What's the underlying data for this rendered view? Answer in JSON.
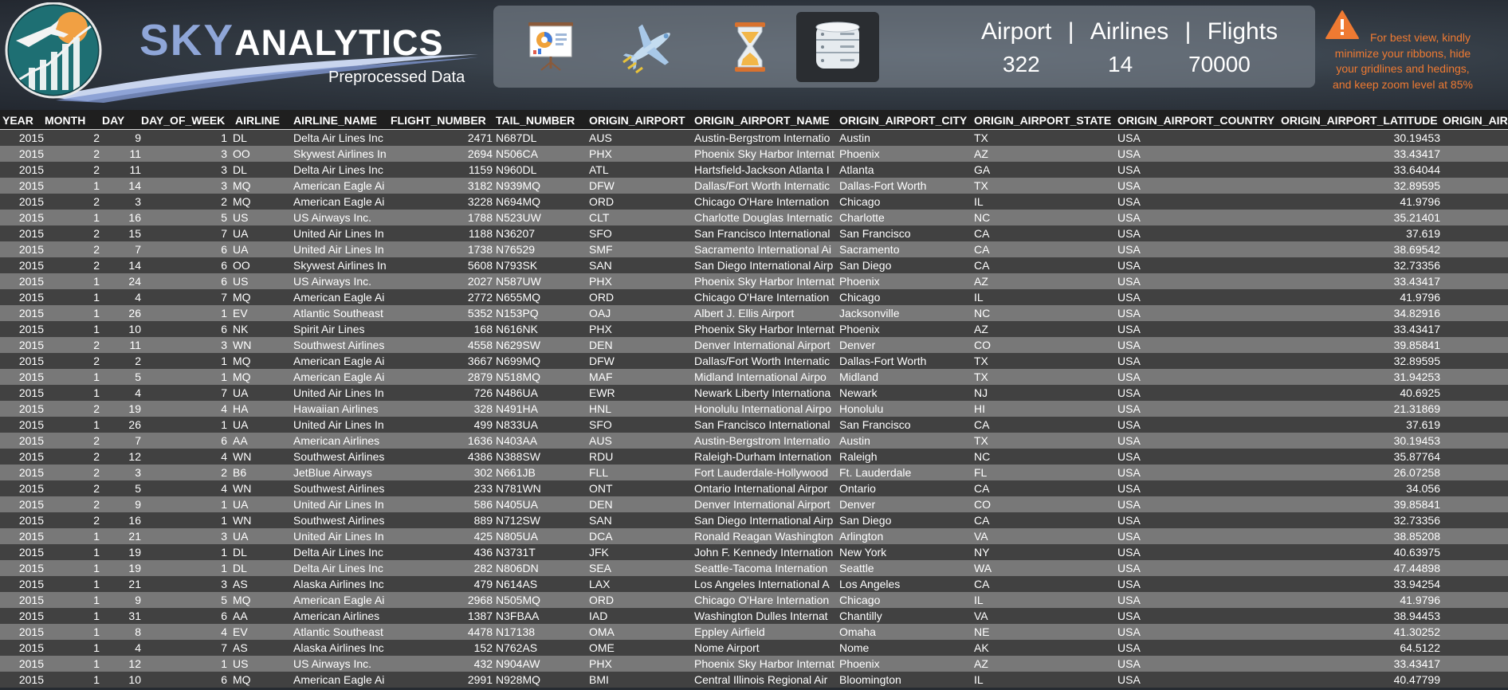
{
  "header": {
    "brand_sky": "SKY",
    "brand_analytics": "ANALYTICS",
    "subtitle": "Preprocessed Data",
    "nav": [
      {
        "name": "dashboard-presentation-icon",
        "active": false
      },
      {
        "name": "airplane-icon",
        "active": false
      },
      {
        "name": "hourglass-icon",
        "active": false
      },
      {
        "name": "database-icon",
        "active": true
      }
    ],
    "stats": {
      "labels": [
        "Airport",
        "Airlines",
        "Flights"
      ],
      "separator": "|",
      "values": [
        "322",
        "14",
        "70000"
      ]
    },
    "warning": {
      "icon": "warning-triangle-icon",
      "lines": [
        "For best view, kindly",
        "minimize your ribbons, hide",
        "your gridlines and hedings,",
        "and keep zoom level at 85%"
      ],
      "color": "#ef7a32"
    },
    "colors": {
      "brand_blue": "#8fa6d8",
      "active_tab": "#2a2d31",
      "row_dark": "#414141",
      "row_light": "#787878"
    }
  },
  "table": {
    "columns": [
      "YEAR",
      "MONTH",
      "DAY",
      "DAY_OF_WEEK",
      "AIRLINE",
      "AIRLINE_NAME",
      "FLIGHT_NUMBER",
      "TAIL_NUMBER",
      "ORIGIN_AIRPORT",
      "ORIGIN_AIRPORT_NAME",
      "ORIGIN_AIRPORT_CITY",
      "ORIGIN_AIRPORT_STATE",
      "ORIGIN_AIRPORT_COUNTRY",
      "ORIGIN_AIRPORT_LATITUDE",
      "ORIGIN_AIR"
    ],
    "rows": [
      [
        "2015",
        "2",
        "9",
        "1",
        "DL",
        "Delta Air Lines Inc",
        "2471",
        "N687DL",
        "AUS",
        "Austin-Bergstrom Internatio",
        "Austin",
        "TX",
        "USA",
        "30.19453"
      ],
      [
        "2015",
        "2",
        "11",
        "3",
        "OO",
        "Skywest Airlines In",
        "2694",
        "N506CA",
        "PHX",
        "Phoenix Sky Harbor Internat",
        "Phoenix",
        "AZ",
        "USA",
        "33.43417"
      ],
      [
        "2015",
        "2",
        "11",
        "3",
        "DL",
        "Delta Air Lines Inc",
        "1159",
        "N960DL",
        "ATL",
        "Hartsfield-Jackson Atlanta I",
        "Atlanta",
        "GA",
        "USA",
        "33.64044"
      ],
      [
        "2015",
        "1",
        "14",
        "3",
        "MQ",
        "American Eagle Ai",
        "3182",
        "N939MQ",
        "DFW",
        "Dallas/Fort Worth Internatic",
        "Dallas-Fort Worth",
        "TX",
        "USA",
        "32.89595"
      ],
      [
        "2015",
        "2",
        "3",
        "2",
        "MQ",
        "American Eagle Ai",
        "3228",
        "N694MQ",
        "ORD",
        "Chicago O'Hare Internation",
        "Chicago",
        "IL",
        "USA",
        "41.9796"
      ],
      [
        "2015",
        "1",
        "16",
        "5",
        "US",
        "US Airways Inc.",
        "1788",
        "N523UW",
        "CLT",
        "Charlotte Douglas Internatic",
        "Charlotte",
        "NC",
        "USA",
        "35.21401"
      ],
      [
        "2015",
        "2",
        "15",
        "7",
        "UA",
        "United Air Lines In",
        "1188",
        "N36207",
        "SFO",
        "San Francisco International",
        "San Francisco",
        "CA",
        "USA",
        "37.619"
      ],
      [
        "2015",
        "2",
        "7",
        "6",
        "UA",
        "United Air Lines In",
        "1738",
        "N76529",
        "SMF",
        "Sacramento International Ai",
        "Sacramento",
        "CA",
        "USA",
        "38.69542"
      ],
      [
        "2015",
        "2",
        "14",
        "6",
        "OO",
        "Skywest Airlines In",
        "5608",
        "N793SK",
        "SAN",
        "San Diego International Airp",
        "San Diego",
        "CA",
        "USA",
        "32.73356"
      ],
      [
        "2015",
        "1",
        "24",
        "6",
        "US",
        "US Airways Inc.",
        "2027",
        "N587UW",
        "PHX",
        "Phoenix Sky Harbor Internat",
        "Phoenix",
        "AZ",
        "USA",
        "33.43417"
      ],
      [
        "2015",
        "1",
        "4",
        "7",
        "MQ",
        "American Eagle Ai",
        "2772",
        "N655MQ",
        "ORD",
        "Chicago O'Hare Internation",
        "Chicago",
        "IL",
        "USA",
        "41.9796"
      ],
      [
        "2015",
        "1",
        "26",
        "1",
        "EV",
        "Atlantic Southeast",
        "5352",
        "N153PQ",
        "OAJ",
        "Albert J. Ellis Airport",
        "Jacksonville",
        "NC",
        "USA",
        "34.82916"
      ],
      [
        "2015",
        "1",
        "10",
        "6",
        "NK",
        "Spirit Air Lines",
        "168",
        "N616NK",
        "PHX",
        "Phoenix Sky Harbor Internat",
        "Phoenix",
        "AZ",
        "USA",
        "33.43417"
      ],
      [
        "2015",
        "2",
        "11",
        "3",
        "WN",
        "Southwest Airlines",
        "4558",
        "N629SW",
        "DEN",
        "Denver International Airport",
        "Denver",
        "CO",
        "USA",
        "39.85841"
      ],
      [
        "2015",
        "2",
        "2",
        "1",
        "MQ",
        "American Eagle Ai",
        "3667",
        "N699MQ",
        "DFW",
        "Dallas/Fort Worth Internatic",
        "Dallas-Fort Worth",
        "TX",
        "USA",
        "32.89595"
      ],
      [
        "2015",
        "1",
        "5",
        "1",
        "MQ",
        "American Eagle Ai",
        "2879",
        "N518MQ",
        "MAF",
        "Midland International Airpo",
        "Midland",
        "TX",
        "USA",
        "31.94253"
      ],
      [
        "2015",
        "1",
        "4",
        "7",
        "UA",
        "United Air Lines In",
        "726",
        "N486UA",
        "EWR",
        "Newark Liberty Internationa",
        "Newark",
        "NJ",
        "USA",
        "40.6925"
      ],
      [
        "2015",
        "2",
        "19",
        "4",
        "HA",
        "Hawaiian Airlines",
        "328",
        "N491HA",
        "HNL",
        "Honolulu International Airpo",
        "Honolulu",
        "HI",
        "USA",
        "21.31869"
      ],
      [
        "2015",
        "1",
        "26",
        "1",
        "UA",
        "United Air Lines In",
        "499",
        "N833UA",
        "SFO",
        "San Francisco International",
        "San Francisco",
        "CA",
        "USA",
        "37.619"
      ],
      [
        "2015",
        "2",
        "7",
        "6",
        "AA",
        "American Airlines",
        "1636",
        "N403AA",
        "AUS",
        "Austin-Bergstrom Internatio",
        "Austin",
        "TX",
        "USA",
        "30.19453"
      ],
      [
        "2015",
        "2",
        "12",
        "4",
        "WN",
        "Southwest Airlines",
        "4386",
        "N388SW",
        "RDU",
        "Raleigh-Durham Internation",
        "Raleigh",
        "NC",
        "USA",
        "35.87764"
      ],
      [
        "2015",
        "2",
        "3",
        "2",
        "B6",
        "JetBlue Airways",
        "302",
        "N661JB",
        "FLL",
        "Fort Lauderdale-Hollywood",
        "Ft. Lauderdale",
        "FL",
        "USA",
        "26.07258"
      ],
      [
        "2015",
        "2",
        "5",
        "4",
        "WN",
        "Southwest Airlines",
        "233",
        "N781WN",
        "ONT",
        "Ontario International Airpor",
        "Ontario",
        "CA",
        "USA",
        "34.056"
      ],
      [
        "2015",
        "2",
        "9",
        "1",
        "UA",
        "United Air Lines In",
        "586",
        "N405UA",
        "DEN",
        "Denver International Airport",
        "Denver",
        "CO",
        "USA",
        "39.85841"
      ],
      [
        "2015",
        "2",
        "16",
        "1",
        "WN",
        "Southwest Airlines",
        "889",
        "N712SW",
        "SAN",
        "San Diego International Airp",
        "San Diego",
        "CA",
        "USA",
        "32.73356"
      ],
      [
        "2015",
        "1",
        "21",
        "3",
        "UA",
        "United Air Lines In",
        "425",
        "N805UA",
        "DCA",
        "Ronald Reagan Washington",
        "Arlington",
        "VA",
        "USA",
        "38.85208"
      ],
      [
        "2015",
        "1",
        "19",
        "1",
        "DL",
        "Delta Air Lines Inc",
        "436",
        "N3731T",
        "JFK",
        "John F. Kennedy Internation",
        "New York",
        "NY",
        "USA",
        "40.63975"
      ],
      [
        "2015",
        "1",
        "19",
        "1",
        "DL",
        "Delta Air Lines Inc",
        "282",
        "N806DN",
        "SEA",
        "Seattle-Tacoma Internation",
        "Seattle",
        "WA",
        "USA",
        "47.44898"
      ],
      [
        "2015",
        "1",
        "21",
        "3",
        "AS",
        "Alaska Airlines Inc",
        "479",
        "N614AS",
        "LAX",
        "Los Angeles International A",
        "Los Angeles",
        "CA",
        "USA",
        "33.94254"
      ],
      [
        "2015",
        "1",
        "9",
        "5",
        "MQ",
        "American Eagle Ai",
        "2968",
        "N505MQ",
        "ORD",
        "Chicago O'Hare Internation",
        "Chicago",
        "IL",
        "USA",
        "41.9796"
      ],
      [
        "2015",
        "1",
        "31",
        "6",
        "AA",
        "American Airlines",
        "1387",
        "N3FBAA",
        "IAD",
        "Washington Dulles Internat",
        "Chantilly",
        "VA",
        "USA",
        "38.94453"
      ],
      [
        "2015",
        "1",
        "8",
        "4",
        "EV",
        "Atlantic Southeast",
        "4478",
        "N17138",
        "OMA",
        "Eppley Airfield",
        "Omaha",
        "NE",
        "USA",
        "41.30252"
      ],
      [
        "2015",
        "1",
        "4",
        "7",
        "AS",
        "Alaska Airlines Inc",
        "152",
        "N762AS",
        "OME",
        "Nome Airport",
        "Nome",
        "AK",
        "USA",
        "64.5122"
      ],
      [
        "2015",
        "1",
        "12",
        "1",
        "US",
        "US Airways Inc.",
        "432",
        "N904AW",
        "PHX",
        "Phoenix Sky Harbor Internat",
        "Phoenix",
        "AZ",
        "USA",
        "33.43417"
      ],
      [
        "2015",
        "1",
        "10",
        "6",
        "MQ",
        "American Eagle Ai",
        "2991",
        "N928MQ",
        "BMI",
        "Central Illinois Regional Air",
        "Bloomington",
        "IL",
        "USA",
        "40.47799"
      ]
    ]
  }
}
